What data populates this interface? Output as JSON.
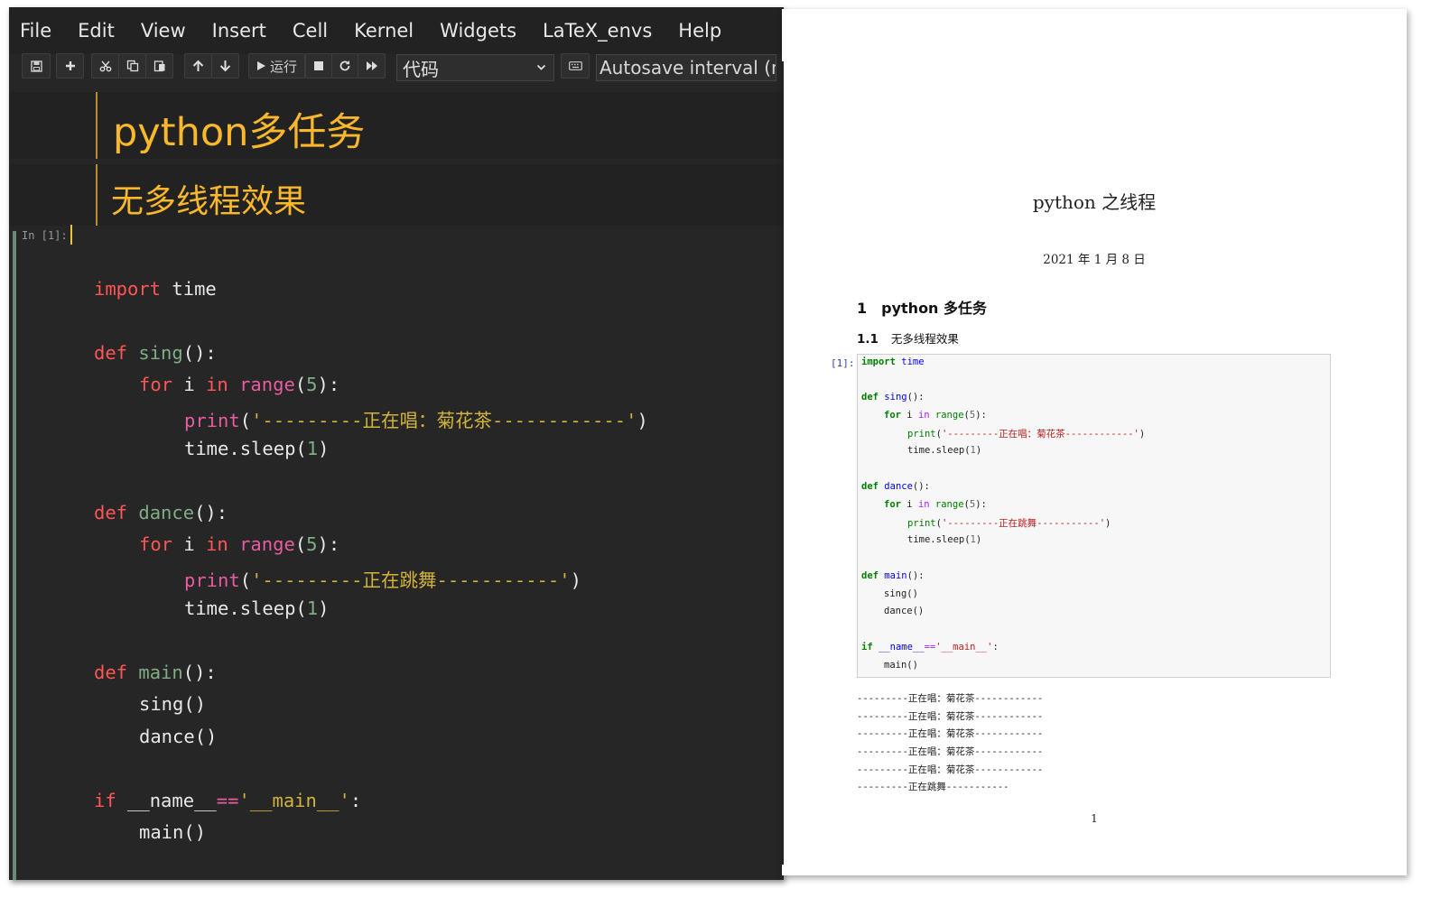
{
  "menubar": {
    "items": [
      "File",
      "Edit",
      "View",
      "Insert",
      "Cell",
      "Kernel",
      "Widgets",
      "LaTeX_envs",
      "Help"
    ]
  },
  "toolbar": {
    "run_label": "运行",
    "cell_type": "代码",
    "autosave": "Autosave interval (min)"
  },
  "notebook": {
    "h1": "python多任务",
    "h2": "无多线程效果",
    "prompt": "In [1]:",
    "code": {
      "l1_kw": "import",
      "l1_rest": " time",
      "def": "def",
      "sing": "sing",
      "dance": "dance",
      "main": "main",
      "parens_colon": "():",
      "for": "for",
      "i": " i ",
      "in": "in",
      "range": "range",
      "five": "5",
      "close_colon": "):",
      "print": "print",
      "str_sing": "'---------正在唱：菊花茶------------'",
      "str_dance": "'---------正在跳舞-----------'",
      "time_sleep": "time.sleep(",
      "one": "1",
      "close": ")",
      "sing_call": "sing()",
      "dance_call": "dance()",
      "if": "if",
      "name_var": " __name__",
      "eqeq": "==",
      "main_str": "'__main__'",
      "colon": ":",
      "main_call": "main()"
    }
  },
  "pdf": {
    "title": "python 之线程",
    "date": "2021 年 1 月 8 日",
    "section_num": "1",
    "section_title": "python 多任务",
    "subsection_num": "1.1",
    "subsection_title": "无多线程效果",
    "prompt": "[1]:",
    "code": {
      "import": "import",
      "time_mod": " time",
      "def": "def",
      "sing": "sing",
      "dance": "dance",
      "main": "main",
      "paren": "():",
      "for": "for",
      "i": " i ",
      "in": "in",
      "range": " range",
      "five": "5",
      "close_colon": "):",
      "print": "print",
      "str_sing": "'---------正在唱：菊花茶------------'",
      "str_dance": "'---------正在跳舞-----------'",
      "time_sleep": "time.sleep(",
      "one": "1",
      "close": ")",
      "sing_call": "sing()",
      "dance_call": "dance()",
      "if": "if",
      "name_var": " __name__",
      "eqeq": "==",
      "main_str": "'__main__'",
      "colon": ":",
      "main_call": "main()"
    },
    "output": [
      "---------正在唱：菊花茶------------",
      "---------正在唱：菊花茶------------",
      "---------正在唱：菊花茶------------",
      "---------正在唱：菊花茶------------",
      "---------正在唱：菊花茶------------",
      "---------正在跳舞-----------"
    ],
    "page_number": "1"
  },
  "colors": {
    "heading": "#f9b72b",
    "notebook_bg": "#262626",
    "keyword": "#ff5555",
    "string": "#d2b43c"
  }
}
